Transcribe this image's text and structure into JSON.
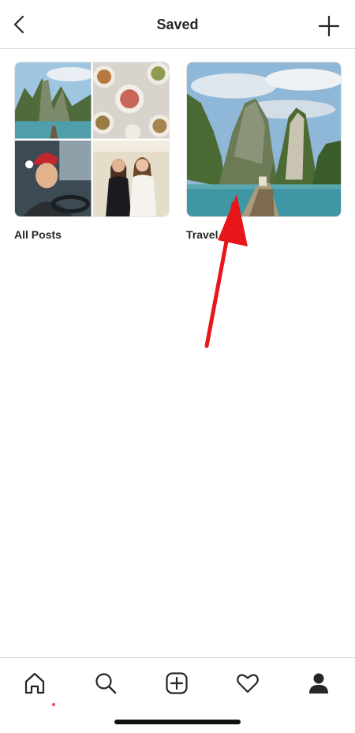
{
  "header": {
    "title": "Saved",
    "back_icon": "chevron-left-icon",
    "add_icon": "plus-icon"
  },
  "collections": [
    {
      "label": "All Posts",
      "thumbnail_icon": "photo-grid-icon"
    },
    {
      "label": "Travel",
      "thumbnail_icon": "landscape-photo-icon"
    }
  ],
  "tabbar": {
    "items": [
      {
        "icon": "home-icon",
        "active": true
      },
      {
        "icon": "search-icon"
      },
      {
        "icon": "new-post-icon"
      },
      {
        "icon": "heart-icon"
      },
      {
        "icon": "profile-icon"
      }
    ],
    "notification_dot_color": "#ed4956"
  },
  "annotation": {
    "icon": "red-arrow-icon",
    "color": "#e8161b"
  }
}
